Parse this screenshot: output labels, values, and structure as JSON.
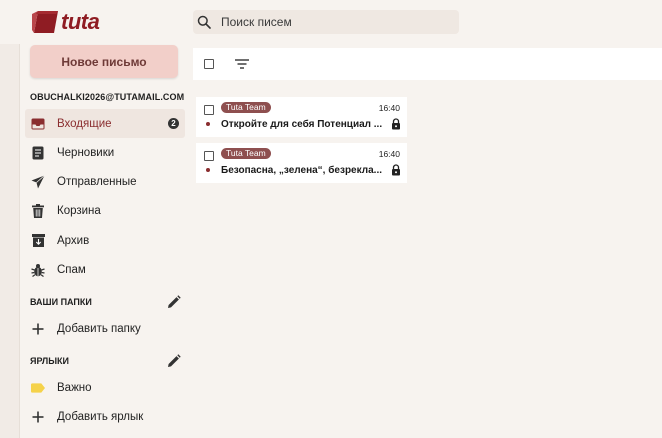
{
  "app": {
    "logo_text": "tuta",
    "brand_color": "#8f1c23"
  },
  "search": {
    "placeholder": "Поиск писем",
    "icon": "search-icon"
  },
  "sidebar": {
    "compose_label": "Новое письмо",
    "account": "OBUCHALKI2026@TUTAMAIL.COM",
    "items": [
      {
        "label": "Входящие",
        "icon": "inbox-icon",
        "badge": "2",
        "active": true
      },
      {
        "label": "Черновики",
        "icon": "draft-icon"
      },
      {
        "label": "Отправленные",
        "icon": "send-icon"
      },
      {
        "label": "Корзина",
        "icon": "trash-icon"
      },
      {
        "label": "Архив",
        "icon": "archive-icon"
      },
      {
        "label": "Спам",
        "icon": "bug-icon"
      }
    ],
    "folders": {
      "title": "ВАШИ ПАПКИ",
      "add_label": "Добавить папку"
    },
    "labels": {
      "title": "ЯРЛЫКИ",
      "items": [
        {
          "label": "Важно",
          "color": "#f5d24a"
        }
      ],
      "add_label": "Добавить ярлык"
    }
  },
  "mail_list": {
    "items": [
      {
        "sender": "Tuta Team",
        "time": "16:40",
        "subject": "Откройте для себя Потенциал ...",
        "unread": true
      },
      {
        "sender": "Tuta Team",
        "time": "16:40",
        "subject": "Безопасна, „зелена“, безрекла...",
        "unread": true
      }
    ]
  }
}
